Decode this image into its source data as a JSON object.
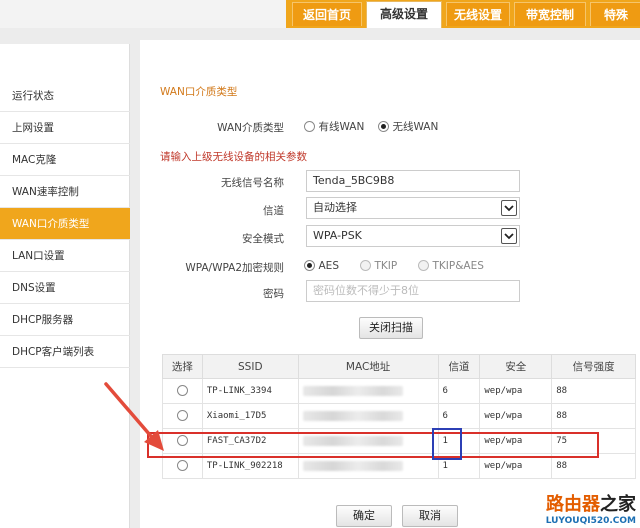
{
  "nav": {
    "tabs": [
      "返回首页",
      "高级设置",
      "无线设置",
      "带宽控制",
      "特殊"
    ],
    "active": "高级设置"
  },
  "sidebar": {
    "items": [
      "运行状态",
      "上网设置",
      "MAC克隆",
      "WAN速率控制",
      "WAN口介质类型",
      "LAN口设置",
      "DNS设置",
      "DHCP服务器",
      "DHCP客户端列表"
    ],
    "active": "WAN口介质类型"
  },
  "form": {
    "title": "WAN口介质类型",
    "media_label": "WAN介质类型",
    "media_options": [
      "有线WAN",
      "无线WAN"
    ],
    "media_selected": "无线WAN",
    "note": "请输入上级无线设备的相关参数",
    "ssid_label": "无线信号名称",
    "ssid_value": "Tenda_5BC9B8",
    "channel_label": "信道",
    "channel_value": "自动选择",
    "security_label": "安全模式",
    "security_value": "WPA-PSK",
    "cipher_label": "WPA/WPA2加密规则",
    "cipher_options": [
      "AES",
      "TKIP",
      "TKIP&AES"
    ],
    "cipher_selected": "AES",
    "password_label": "密码",
    "password_placeholder": "密码位数不得少于8位",
    "scan_button": "关闭扫描"
  },
  "table": {
    "headers": [
      "选择",
      "SSID",
      "MAC地址",
      "信道",
      "安全",
      "信号强度"
    ],
    "rows": [
      {
        "ssid": "TP-LINK_3394",
        "channel": "6",
        "security": "wep/wpa",
        "signal": "88"
      },
      {
        "ssid": "Xiaomi_17D5",
        "channel": "6",
        "security": "wep/wpa",
        "signal": "88"
      },
      {
        "ssid": "FAST_CA37D2",
        "channel": "1",
        "security": "wep/wpa",
        "signal": "75"
      },
      {
        "ssid": "TP-LINK_902218",
        "channel": "1",
        "security": "wep/wpa",
        "signal": "88"
      }
    ]
  },
  "actions": {
    "ok": "确定",
    "cancel": "取消"
  },
  "watermark": {
    "name_a": "路由器",
    "name_b": "之家",
    "url": "LUYOUQI520.COM"
  },
  "colors": {
    "accent": "#f0a61c",
    "highlight_row": "#d9302a",
    "highlight_cell": "#2c3fb5",
    "arrow": "#e34b3b"
  }
}
